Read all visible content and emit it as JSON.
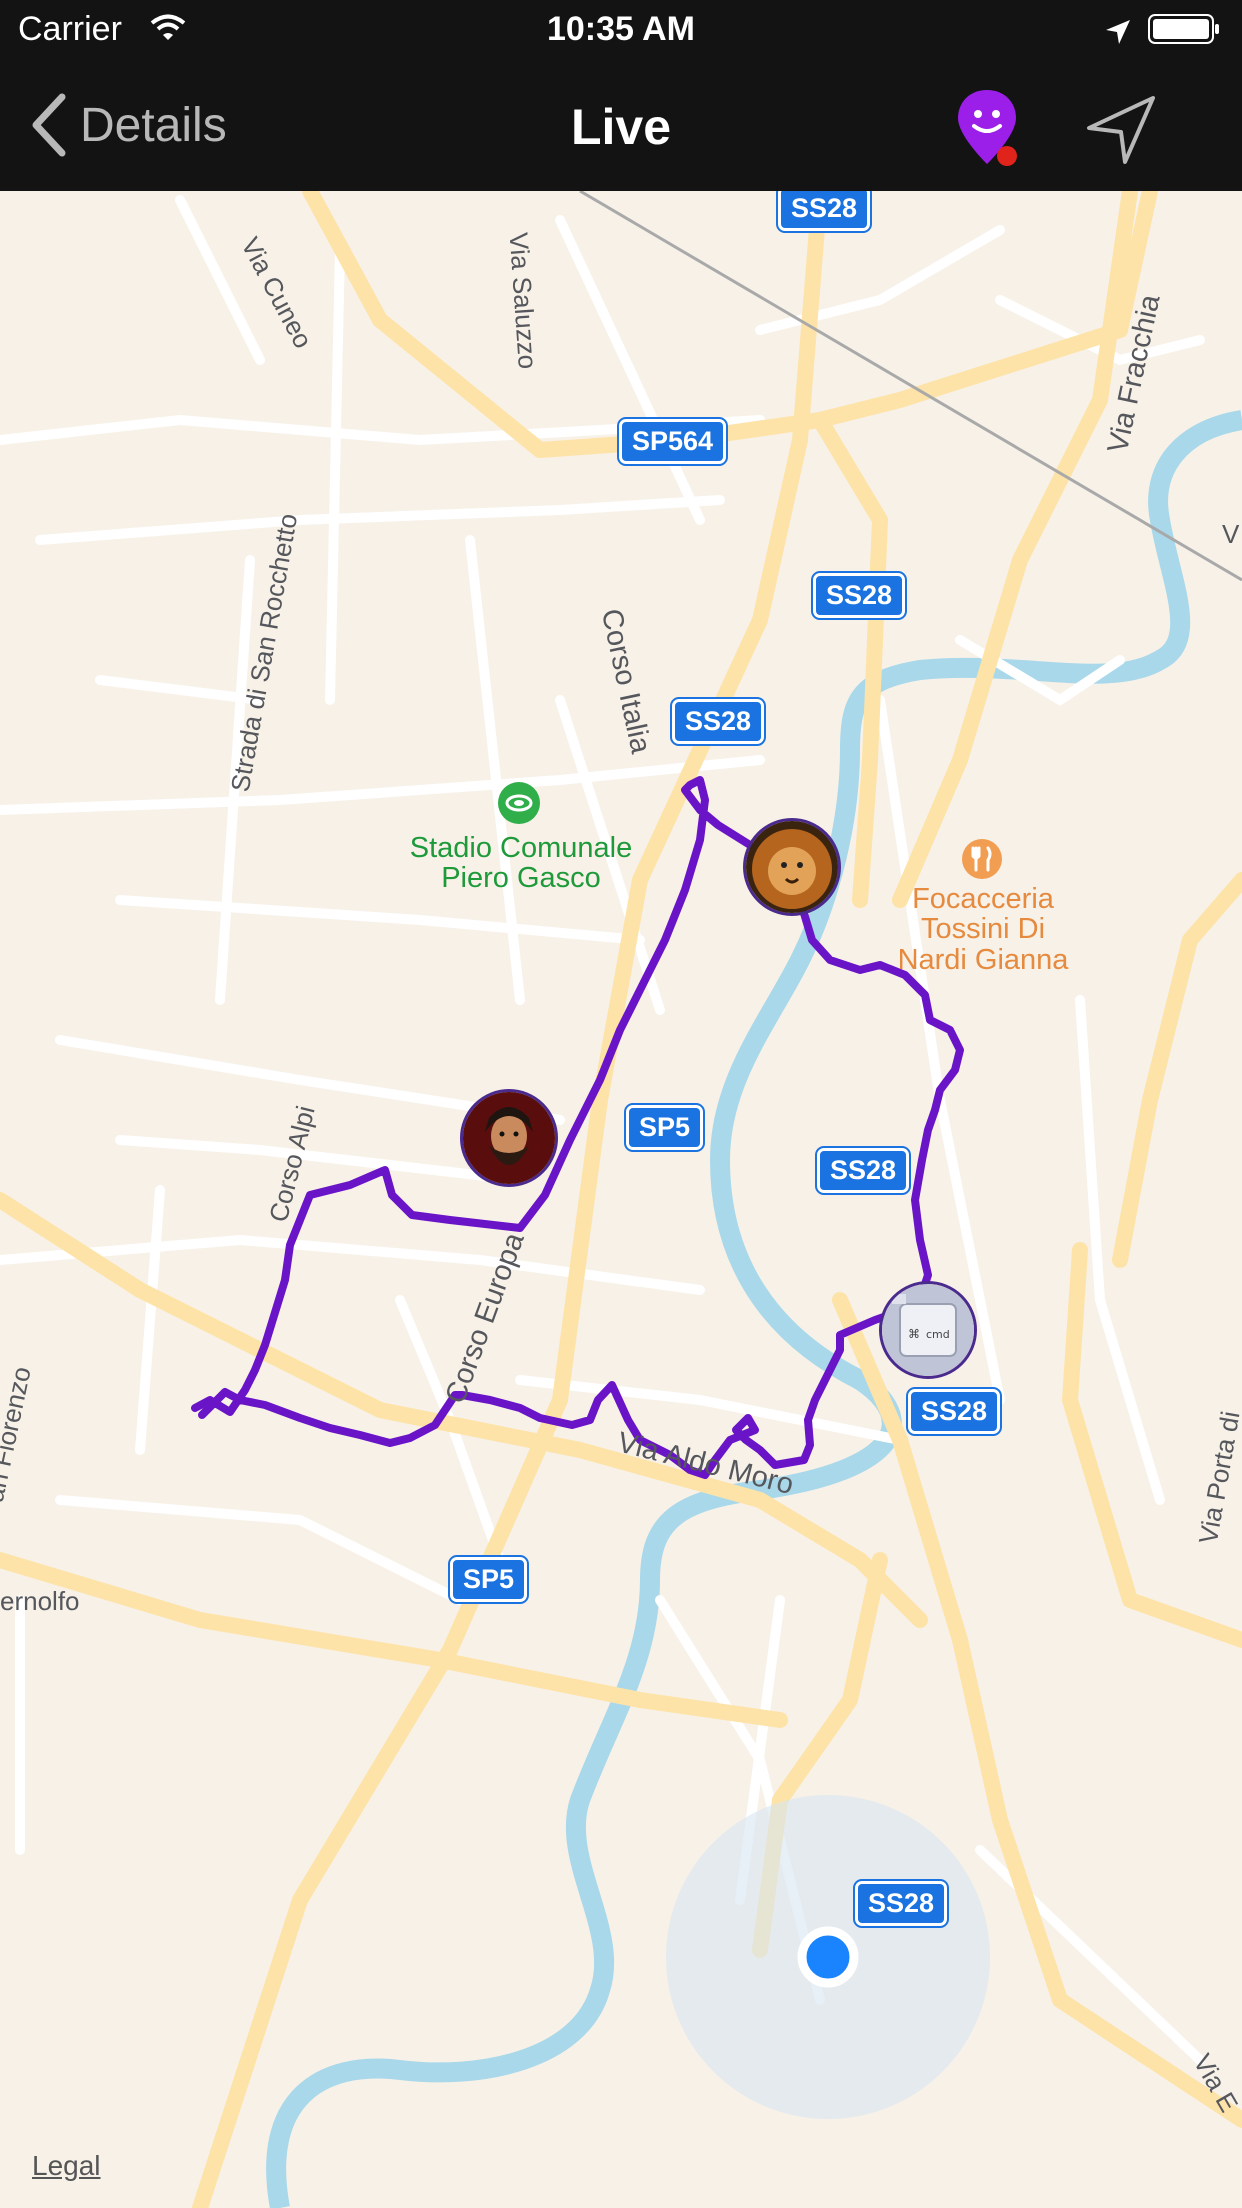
{
  "status_bar": {
    "carrier": "Carrier",
    "time": "10:35 AM"
  },
  "nav": {
    "back_label": "Details",
    "title": "Live",
    "pin_icon": "smiley-map-pin-icon",
    "location_arrow_icon": "navigation-arrow-icon"
  },
  "map": {
    "shields": [
      "SS28",
      "SP564",
      "SS28",
      "SS28",
      "SP5",
      "SS28",
      "SS28",
      "SP5",
      "SS28"
    ],
    "road_labels": [
      "Via Cuneo",
      "Via Saluzzo",
      "Strada di San Rocchetto",
      "Corso Italia",
      "Via Fracchia",
      "Corso Alpi",
      "Corso Europa",
      "Via Aldo Moro",
      "an Fiorenzo",
      "ernolfo",
      "Via Porta di",
      "Via E",
      "V"
    ],
    "poi_stadium": "Stadio Comunale\nPiero Gasco",
    "poi_food": "Focacceria\nTossini Di\nNardi Gianna",
    "legal": "Legal",
    "colors": {
      "route": "#6a14c7",
      "water": "#a8d8ea",
      "road_major": "#fde3a7",
      "user_location": "#1a84ff"
    }
  }
}
